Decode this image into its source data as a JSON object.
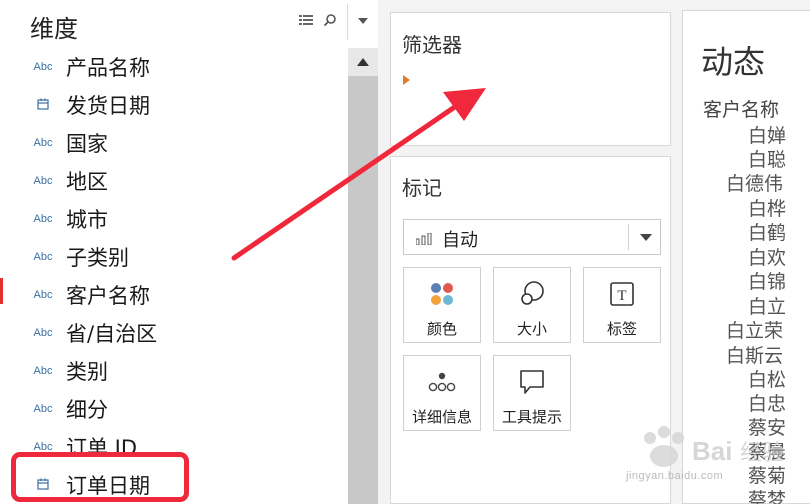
{
  "dimensions": {
    "title": "维度",
    "fields": [
      {
        "type_label": "Abc",
        "kind": "text",
        "name": "产品名称"
      },
      {
        "type_label": "",
        "kind": "date",
        "name": "发货日期"
      },
      {
        "type_label": "Abc",
        "kind": "text",
        "name": "国家"
      },
      {
        "type_label": "Abc",
        "kind": "text",
        "name": "地区"
      },
      {
        "type_label": "Abc",
        "kind": "text",
        "name": "城市"
      },
      {
        "type_label": "Abc",
        "kind": "text",
        "name": "子类别"
      },
      {
        "type_label": "Abc",
        "kind": "text",
        "name": "客户名称"
      },
      {
        "type_label": "Abc",
        "kind": "text",
        "name": "省/自治区"
      },
      {
        "type_label": "Abc",
        "kind": "text",
        "name": "类别"
      },
      {
        "type_label": "Abc",
        "kind": "text",
        "name": "细分"
      },
      {
        "type_label": "Abc",
        "kind": "text",
        "name": "订单 ID"
      },
      {
        "type_label": "",
        "kind": "date",
        "name": "订单日期"
      }
    ]
  },
  "filters": {
    "title": "筛选器"
  },
  "marks": {
    "title": "标记",
    "mark_type": "自动",
    "buttons": [
      {
        "label": "颜色",
        "icon": "color-icon"
      },
      {
        "label": "大小",
        "icon": "size-icon"
      },
      {
        "label": "标签",
        "icon": "label-icon"
      },
      {
        "label": "详细信息",
        "icon": "detail-icon"
      },
      {
        "label": "工具提示",
        "icon": "tooltip-icon"
      }
    ]
  },
  "view": {
    "title": "动态",
    "column_header": "客户名称",
    "rows": [
      "白婵",
      "白聪",
      "白德伟",
      "白桦",
      "白鹤",
      "白欢",
      "白锦",
      "白立",
      "白立荣",
      "白斯云",
      "白松",
      "白忠",
      "蔡安",
      "蔡晨",
      "蔡菊",
      "蔡梦"
    ]
  },
  "colors": {
    "highlight": "#f0283c",
    "arrow": "#f0283c",
    "type_label": "#3a6fa5",
    "filters_caret": "#e07b2a"
  },
  "watermark": {
    "text": "jingyan.baidu.com"
  }
}
